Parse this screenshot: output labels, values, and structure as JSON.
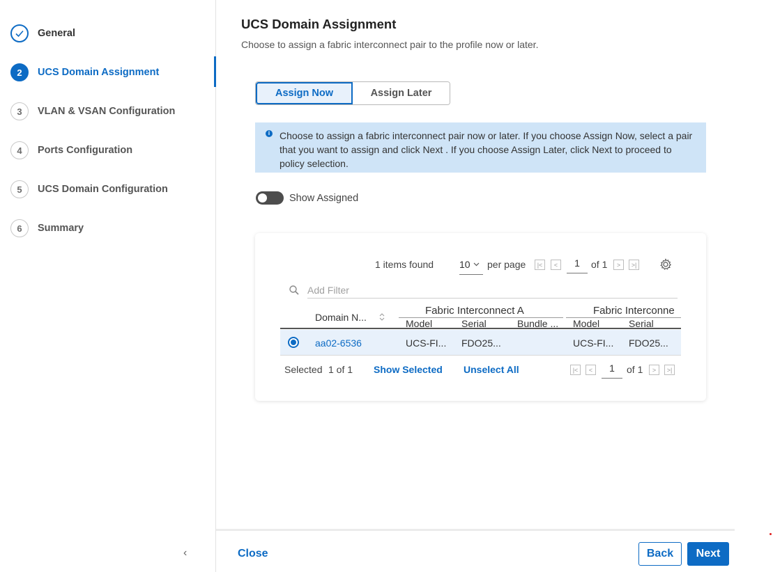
{
  "sidebar": {
    "steps": [
      {
        "number": "✓",
        "label": "General",
        "state": "done"
      },
      {
        "number": "2",
        "label": "UCS Domain Assignment",
        "state": "active"
      },
      {
        "number": "3",
        "label": "VLAN & VSAN Configuration",
        "state": "pending"
      },
      {
        "number": "4",
        "label": "Ports Configuration",
        "state": "pending"
      },
      {
        "number": "5",
        "label": "UCS Domain Configuration",
        "state": "pending"
      },
      {
        "number": "6",
        "label": "Summary",
        "state": "pending"
      }
    ],
    "collapse_glyph": "‹"
  },
  "header": {
    "title": "UCS Domain Assignment",
    "subtitle": "Choose to assign a fabric interconnect pair to the profile now or later."
  },
  "assign_toggle": {
    "now_label": "Assign Now",
    "later_label": "Assign Later",
    "selected": "Assign Now"
  },
  "info_banner": {
    "icon": "info-icon",
    "text": "Choose to assign a fabric interconnect pair now or later. If you choose Assign Now, select a pair that you want to assign and click Next . If you choose Assign Later, click Next to proceed to policy selection."
  },
  "show_assigned": {
    "label": "Show Assigned",
    "enabled": false
  },
  "table": {
    "items_found": "1 items found",
    "per_page_value": "10",
    "per_page_label": "per page",
    "page_current": "1",
    "page_total": "of 1",
    "filter_placeholder": "Add Filter",
    "columns": {
      "domain_name": "Domain N...",
      "group_a": "Fabric Interconnect A",
      "group_b": "Fabric Interconne",
      "model_a": "Model",
      "serial_a": "Serial",
      "bundle_a": "Bundle ...",
      "model_b": "Model",
      "serial_b": "Serial"
    },
    "rows": [
      {
        "domain_name": "aa02-6536",
        "model_a": "UCS-FI...",
        "serial_a": "FDO25...",
        "bundle_a": "",
        "model_b": "UCS-FI...",
        "serial_b": "FDO25...",
        "selected": true
      }
    ],
    "selected_prefix": "Selected",
    "selected_count": "1 of 1",
    "show_selected": "Show Selected",
    "unselect_all": "Unselect All",
    "bottom_page_current": "1",
    "bottom_page_total": "of 1"
  },
  "footer": {
    "close_label": "Close",
    "back_label": "Back",
    "next_label": "Next"
  },
  "colors": {
    "accent": "#0d6bc4",
    "info_bg": "#cfe4f7",
    "row_selected_bg": "#e8f1fb"
  }
}
